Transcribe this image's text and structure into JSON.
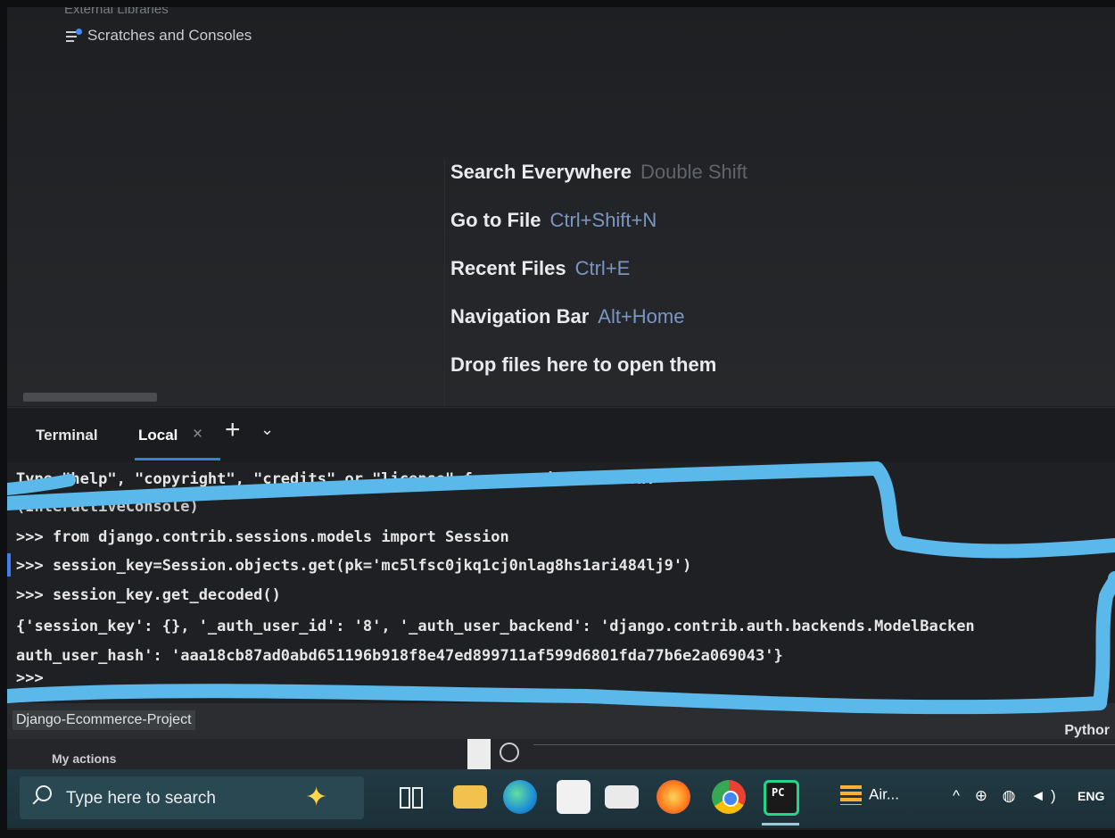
{
  "project_tree": {
    "partial_item": "External Libraries",
    "scratches_label": "Scratches and Consoles"
  },
  "hints": [
    {
      "label": "Search Everywhere",
      "shortcut": "Double Shift"
    },
    {
      "label": "Go to File",
      "shortcut": "Ctrl+Shift+N"
    },
    {
      "label": "Recent Files",
      "shortcut": "Ctrl+E"
    },
    {
      "label": "Navigation Bar",
      "shortcut": "Alt+Home"
    },
    {
      "label": "Drop files here to open them",
      "shortcut": ""
    }
  ],
  "terminal": {
    "title": "Terminal",
    "tab_label": "Local",
    "close_glyph": "×",
    "add_glyph": "+",
    "menu_glyph": "⌄",
    "lines": [
      "Type \"help\", \"copyright\", \"credits\" or \"license\" for more information.",
      "(InteractiveConsole)",
      ">>> from django.contrib.sessions.models import Session",
      ">>> session_key=Session.objects.get(pk='mc5lfsc0jkq1cj0nlag8hs1ari484lj9')",
      ">>> session_key.get_decoded()",
      "{'session_key': {}, '_auth_user_id': '8', '_auth_user_backend': 'django.contrib.auth.backends.ModelBacken",
      "auth_user_hash': 'aaa18cb87ad0abd651196b918f8e47ed899711af599d6801fda77b6e2a069043'}",
      ">>>"
    ]
  },
  "status_bar": {
    "project_name": "Django-Ecommerce-Project",
    "interpreter": "Pythor"
  },
  "lower_pane": {
    "label": "My actions"
  },
  "taskbar": {
    "search_placeholder": "Type here to search",
    "air_label": "Air...",
    "tray_glyphs": "^ ⊕ ◍ ◄)",
    "language": "ENG",
    "pycharm_glyph": "PC"
  },
  "colors": {
    "highlighter": "#5bb8ea",
    "ide_background": "#1e1f22",
    "accent": "#3c7dd9"
  }
}
